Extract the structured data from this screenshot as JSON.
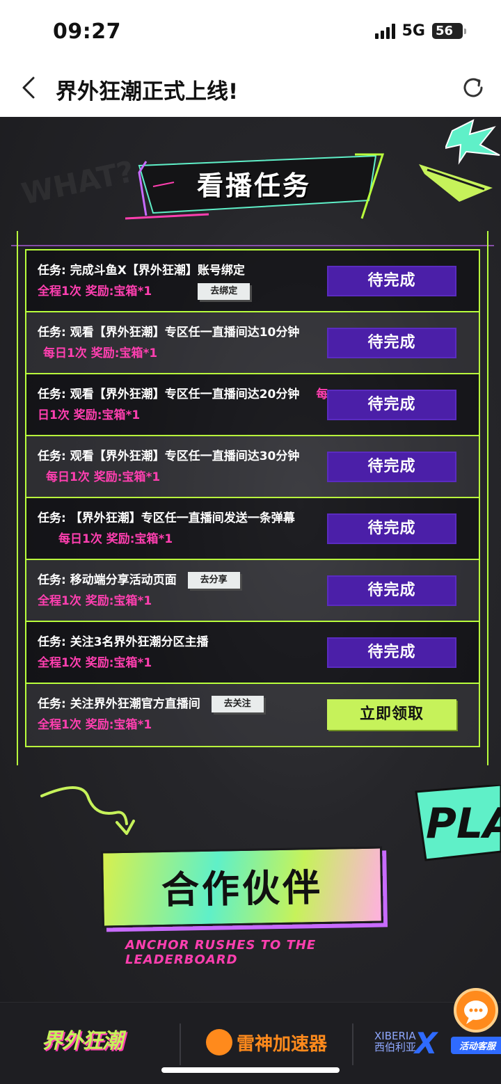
{
  "status_bar": {
    "time": "09:27",
    "network": "5G",
    "battery": "56"
  },
  "nav": {
    "title": "界外狂潮正式上线!"
  },
  "section_title": "看播任务",
  "tasks": [
    {
      "prefix": "任务: ",
      "text": "完成斗鱼X【界外狂潮】账号绑定",
      "reward": "全程1次 奖励:宝箱*1",
      "action": "去绑定",
      "status": "待完成"
    },
    {
      "prefix": "任务: ",
      "text": "观看【界外狂潮】专区任一直播间达10分钟",
      "reward": "每日1次 奖励:宝箱*1",
      "action": "",
      "status": "待完成"
    },
    {
      "prefix": "任务: ",
      "text": "观看【界外狂潮】专区任一直播间达20分钟",
      "reward": "每日1次 奖励:宝箱*1",
      "action": "",
      "status": "待完成"
    },
    {
      "prefix": "任务: ",
      "text": "观看【界外狂潮】专区任一直播间达30分钟",
      "reward": "每日1次 奖励:宝箱*1",
      "action": "",
      "status": "待完成"
    },
    {
      "prefix": "任务: ",
      "text": "【界外狂潮】专区任一直播间发送一条弹幕",
      "reward": "每日1次 奖励:宝箱*1",
      "action": "",
      "status": "待完成"
    },
    {
      "prefix": "任务: ",
      "text": "移动端分享活动页面",
      "reward": "全程1次 奖励:宝箱*1",
      "action": "去分享",
      "status": "待完成"
    },
    {
      "prefix": "任务: ",
      "text": "关注3名界外狂潮分区主播",
      "reward": "全程1次 奖励:宝箱*1",
      "action": "",
      "status": "待完成"
    },
    {
      "prefix": "任务: ",
      "text": "关注界外狂潮官方直播间",
      "reward": "全程1次 奖励:宝箱*1",
      "action": "去关注",
      "status": "立即领取"
    }
  ],
  "partner": {
    "title": "合作伙伴",
    "subtitle": "ANCHOR RUSHES TO THE LEADERBOARD",
    "play_text": "PLAY"
  },
  "footer": {
    "logo1": "界外狂潮",
    "logo2": "雷神加速器",
    "logo3_line1": "XIBERIA",
    "logo3_line2": "西伯利亚",
    "logo3_mark": "X"
  },
  "support": {
    "label": "活动客服"
  },
  "graffiti": {
    "top_left": "WHAT?"
  }
}
